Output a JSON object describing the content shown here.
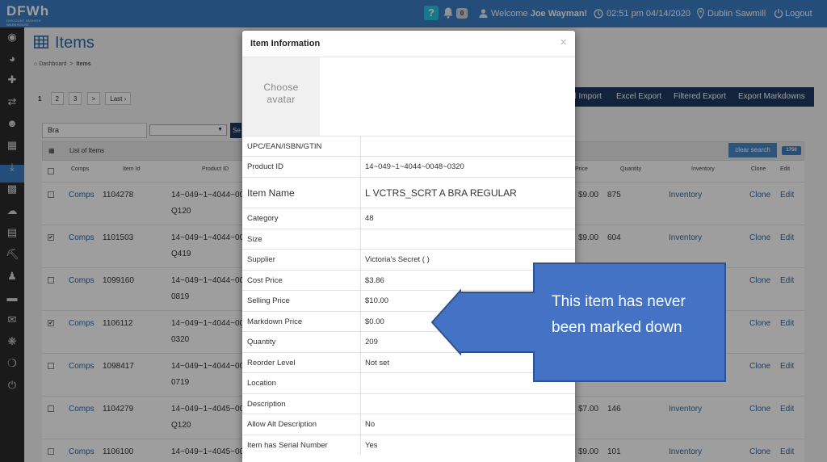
{
  "topbar": {
    "logo_text": "DFWh",
    "logo_subtext": "DISCOUNT FASHION WAREHOUSE",
    "help_label": "?",
    "notification_count": "0",
    "welcome_prefix": "Welcome ",
    "user_name": "Joe Wayman!",
    "datetime": "02:51 pm 04/14/2020",
    "location": "Dublin Sawmill",
    "logout_label": "Logout",
    "bar_color": "#3b7cc4"
  },
  "sidebar": {
    "icons": [
      "map-marker",
      "dashboard",
      "cross-arrows",
      "exchange",
      "users",
      "table",
      "download",
      "bar-chart",
      "cloud",
      "list",
      "cart",
      "user",
      "card",
      "envelope",
      "rebel",
      "life-ring",
      "power"
    ]
  },
  "page": {
    "title": "Items",
    "breadcrumb": [
      "Dashboard",
      "Items"
    ],
    "pager": [
      "1",
      "2",
      "3",
      ">",
      "Last ›"
    ],
    "actions": [
      "el Import",
      "Excel Export",
      "Filtered Export",
      "Export Markdowns"
    ],
    "search_value": "Bra",
    "search_button": "Se",
    "list_title": "List of Items",
    "clear_search": "clear search",
    "total_count": "1750",
    "columns": [
      "Comps",
      "Item Id",
      "Product ID",
      "Price",
      "Quantity",
      "Inventory",
      "Clone",
      "Edit"
    ],
    "rows": [
      {
        "checked": false,
        "comps": "Comps",
        "item_id": "1104278",
        "product_id": "14~049~1~4044~00",
        "product_id_2": "Q120",
        "price": "$9.00",
        "quantity": "875",
        "inventory": "Inventory",
        "clone": "Clone",
        "edit": "Edit"
      },
      {
        "checked": true,
        "comps": "Comps",
        "item_id": "1101503",
        "product_id": "14~049~1~4044~00",
        "product_id_2": "Q419",
        "price": "$9.00",
        "quantity": "604",
        "inventory": "Inventory",
        "clone": "Clone",
        "edit": "Edit"
      },
      {
        "checked": false,
        "comps": "Comps",
        "item_id": "1099160",
        "product_id": "14~049~1~4044~00",
        "product_id_2": "0819",
        "price": "",
        "quantity": "",
        "inventory": "",
        "clone": "Clone",
        "edit": "Edit"
      },
      {
        "checked": true,
        "comps": "Comps",
        "item_id": "1106112",
        "product_id": "14~049~1~4044~00",
        "product_id_2": "0320",
        "price": "",
        "quantity": "",
        "inventory": "",
        "clone": "Clone",
        "edit": "Edit"
      },
      {
        "checked": false,
        "comps": "Comps",
        "item_id": "1098417",
        "product_id": "14~049~1~4044~00",
        "product_id_2": "0719",
        "price": "",
        "quantity": "",
        "inventory": "",
        "clone": "Clone",
        "edit": "Edit"
      },
      {
        "checked": false,
        "comps": "Comps",
        "item_id": "1104279",
        "product_id": "14~049~1~4045~00",
        "product_id_2": "Q120",
        "price": "$7.00",
        "quantity": "146",
        "inventory": "Inventory",
        "clone": "Clone",
        "edit": "Edit"
      },
      {
        "checked": false,
        "comps": "Comps",
        "item_id": "1106100",
        "product_id": "14~049~1~4045~00",
        "product_id_2": "",
        "price": "$9.00",
        "quantity": "101",
        "inventory": "Inventory",
        "clone": "Clone",
        "edit": "Edit"
      }
    ]
  },
  "modal": {
    "title": "Item Information",
    "close": "×",
    "avatar_label": "Choose avatar",
    "fields": [
      {
        "label": "UPC/EAN/ISBN/GTIN",
        "value": ""
      },
      {
        "label": "Product ID",
        "value": "14~049~1~4044~0048~0320"
      },
      {
        "label": "Item Name",
        "value": "L VCTRS_SCRT A BRA REGULAR"
      },
      {
        "label": "Category",
        "value": "48"
      },
      {
        "label": "Size",
        "value": ""
      },
      {
        "label": "Supplier",
        "value": "Victoria's Secret ( )"
      },
      {
        "label": "Cost Price",
        "value": "$3.86"
      },
      {
        "label": "Selling Price",
        "value": "$10.00"
      },
      {
        "label": "Markdown Price",
        "value": "$0.00"
      },
      {
        "label": "Quantity",
        "value": "209"
      },
      {
        "label": "Reorder Level",
        "value": "Not set"
      },
      {
        "label": "Location",
        "value": ""
      },
      {
        "label": "Description",
        "value": ""
      },
      {
        "label": "Allow Alt Description",
        "value": "No"
      },
      {
        "label": "Item has Serial Number",
        "value": "Yes"
      }
    ]
  },
  "callout": {
    "text_line1": "This item has never",
    "text_line2": "been marked down",
    "fill_color": "#4472c4",
    "border_color": "#2f528f"
  }
}
